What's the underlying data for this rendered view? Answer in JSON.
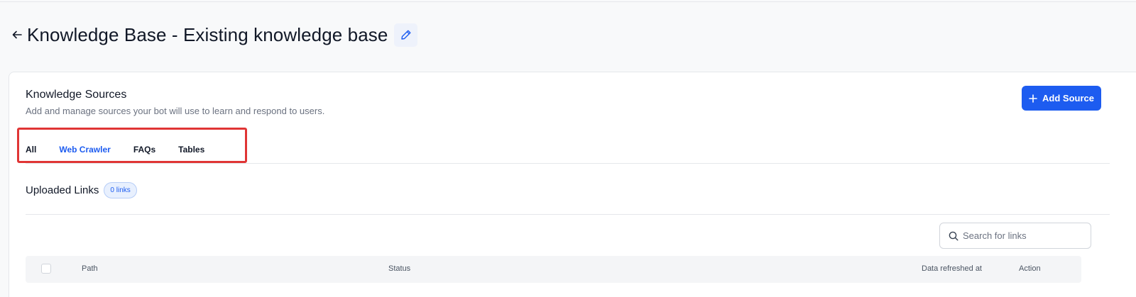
{
  "header": {
    "title": "Knowledge Base - Existing knowledge base",
    "back_icon": "arrow-left-icon",
    "edit_icon": "pencil-icon"
  },
  "sources": {
    "title": "Knowledge Sources",
    "subtitle": "Add and manage sources your bot will use to learn and respond to users.",
    "add_button": "Add Source"
  },
  "tabs": [
    {
      "label": "All",
      "active": false
    },
    {
      "label": "Web Crawler",
      "active": true
    },
    {
      "label": "FAQs",
      "active": false
    },
    {
      "label": "Tables",
      "active": false
    }
  ],
  "uploaded": {
    "title": "Uploaded Links",
    "badge": "0 links"
  },
  "search": {
    "placeholder": "Search for links"
  },
  "table": {
    "columns": [
      "Path",
      "Status",
      "Data refreshed at",
      "Action"
    ]
  },
  "colors": {
    "accent": "#1d5cf0",
    "highlight": "#e03535"
  }
}
